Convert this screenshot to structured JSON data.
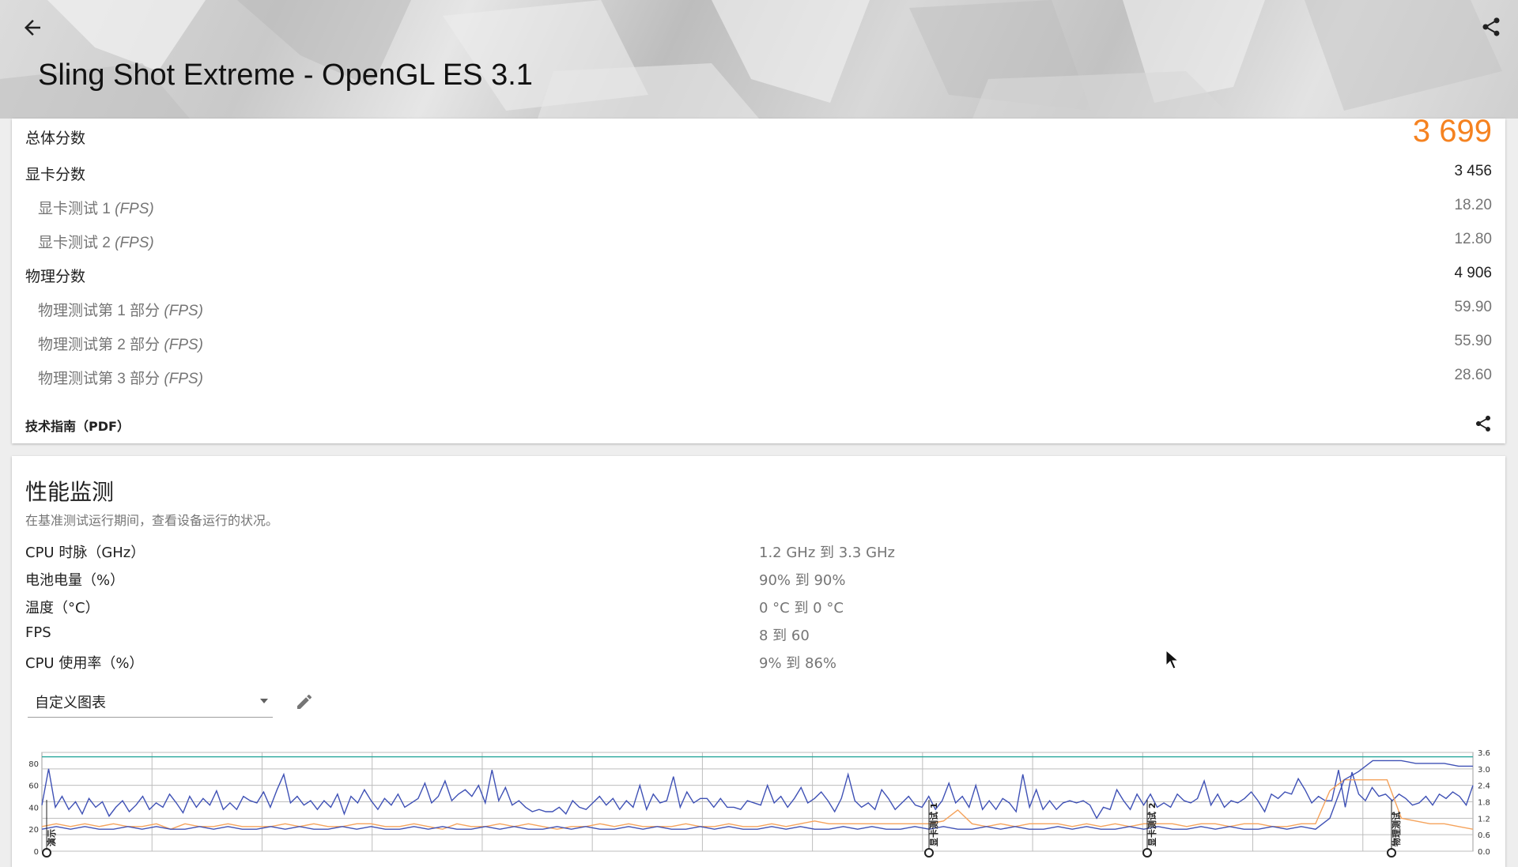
{
  "header": {
    "title": "Sling Shot Extreme - OpenGL ES 3.1",
    "back_icon": "arrow-left-icon",
    "share_icon": "share-icon"
  },
  "scores": {
    "total": {
      "label": "总体分数",
      "value": "3 699"
    },
    "graphics": {
      "label": "显卡分数",
      "value": "3 456"
    },
    "graphics_test1": {
      "label": "显卡测试 1 ",
      "unit": "(FPS)",
      "value": "18.20"
    },
    "graphics_test2": {
      "label": "显卡测试 2 ",
      "unit": "(FPS)",
      "value": "12.80"
    },
    "physics": {
      "label": "物理分数",
      "value": "4 906"
    },
    "physics_test1": {
      "label": "物理测试第 1 部分 ",
      "unit": "(FPS)",
      "value": "59.90"
    },
    "physics_test2": {
      "label": "物理测试第 2 部分 ",
      "unit": "(FPS)",
      "value": "55.90"
    },
    "physics_test3": {
      "label": "物理测试第 3 部分 ",
      "unit": "(FPS)",
      "value": "28.60"
    },
    "pdf_label": "技术指南（PDF）"
  },
  "monitor": {
    "title": "性能监测",
    "description": "在基准测试运行期间，查看设备运行的状况。",
    "stats": [
      {
        "label": "CPU 时脉（GHz）",
        "value": "1.2 GHz 到 3.3 GHz"
      },
      {
        "label": "电池电量（%）",
        "value": "90% 到 90%"
      },
      {
        "label": "温度（°C）",
        "value": "0 °C 到 0 °C"
      },
      {
        "label": "FPS",
        "value": "8 到 60"
      },
      {
        "label": "CPU 使用率（%）",
        "value": "9% 到 86%"
      }
    ],
    "dropdown_value": "自定义图表",
    "edit_icon": "pencil-icon"
  },
  "colors": {
    "accent": "#f58220",
    "fps_line": "#3f51b5",
    "battery_line": "#26a69a",
    "clock_line": "#f5a35c"
  },
  "chart_data": {
    "type": "line",
    "left_axis_ticks": [
      "80",
      "60",
      "40",
      "20",
      "0"
    ],
    "right_axis_ticks": [
      "3.6",
      "3.0",
      "2.4",
      "1.8",
      "1.2",
      "0.6",
      "0.0"
    ],
    "markers": [
      {
        "label": "演示"
      },
      {
        "label": "显卡测试 1"
      },
      {
        "label": "显卡测试 2"
      },
      {
        "label": "物理测试"
      }
    ],
    "series": [
      {
        "color": "#3f51b5",
        "axis": "left",
        "values": [
          42,
          75,
          40,
          50,
          38,
          45,
          34,
          48,
          40,
          45,
          32,
          40,
          46,
          36,
          42,
          50,
          38,
          44,
          40,
          52,
          44,
          35,
          50,
          40,
          48,
          42,
          55,
          38,
          44,
          38,
          50,
          46,
          44,
          54,
          40,
          56,
          70,
          44,
          50,
          42,
          46,
          38,
          46,
          40,
          52,
          34,
          50,
          44,
          56,
          46,
          38,
          48,
          42,
          52,
          40,
          44,
          48,
          62,
          44,
          50,
          64,
          46,
          52,
          56,
          50,
          60,
          44,
          74,
          46,
          58,
          42,
          46,
          40,
          36,
          38,
          36,
          36,
          40,
          34,
          46,
          40,
          38,
          44,
          50,
          42,
          48,
          38,
          46,
          40,
          60,
          38,
          52,
          44,
          46,
          68,
          40,
          54,
          44,
          48,
          48,
          40,
          48,
          40,
          40,
          38,
          46,
          44,
          42,
          60,
          44,
          50,
          40,
          48,
          58,
          44,
          48,
          54,
          46,
          36,
          48,
          70,
          46,
          40,
          44,
          38,
          56,
          48,
          38,
          44,
          50,
          42,
          40,
          50,
          38,
          46,
          62,
          44,
          50,
          40,
          60,
          38,
          46,
          38,
          48,
          44,
          36,
          70,
          40,
          56,
          38,
          46,
          38,
          44,
          46,
          44,
          46,
          42,
          30,
          40,
          38,
          56,
          46,
          38,
          52,
          42,
          52,
          40,
          44,
          40,
          52,
          46,
          44,
          48,
          64,
          42,
          52,
          40,
          46,
          44,
          48,
          54,
          46,
          36,
          52,
          48,
          54,
          52,
          66,
          56,
          44,
          50,
          46,
          46,
          74,
          40,
          72,
          52,
          46,
          58,
          50,
          52,
          46,
          52,
          48,
          42,
          44,
          50,
          42,
          52,
          48,
          54,
          50,
          42,
          60
        ]
      },
      {
        "color": "#26a69a",
        "axis": "left",
        "values": [
          86,
          86,
          86,
          86,
          86,
          86,
          86,
          86,
          86,
          86,
          86,
          86,
          86,
          86,
          86
        ]
      },
      {
        "color": "#f5a35c",
        "axis": "right",
        "values": [
          0.9,
          1.0,
          0.9,
          1.0,
          0.9,
          1.0,
          0.9,
          0.9,
          1.0,
          0.8,
          1.0,
          0.9,
          0.9,
          1.0,
          0.9,
          0.9,
          0.9,
          1.0,
          0.9,
          1.0,
          0.9,
          0.9,
          1.0,
          1.0,
          0.9,
          0.9,
          1.0,
          0.9,
          0.8,
          1.0,
          0.9,
          0.9,
          1.0,
          0.9,
          1.0,
          0.9,
          0.8,
          0.9,
          0.9,
          1.0,
          0.9,
          1.0,
          0.9,
          0.9,
          0.9,
          1.0,
          0.9,
          0.9,
          1.0,
          0.9,
          0.9,
          1.0,
          0.9,
          1.0,
          1.1,
          1.0,
          1.0,
          1.0,
          1.0,
          1.0,
          1.0,
          1.0,
          1.0,
          1.1,
          1.5,
          1.0,
          0.9,
          1.0,
          0.9,
          1.0,
          1.0,
          1.0,
          0.9,
          1.0,
          0.9,
          1.0,
          0.9,
          1.0,
          1.0,
          1.0,
          0.9,
          1.0,
          1.0,
          0.9,
          1.0,
          1.0,
          0.9,
          0.9,
          1.0,
          1.0,
          2.2,
          2.6,
          2.6,
          2.6,
          2.6,
          1.2,
          1.1,
          1.0,
          1.0,
          0.9,
          0.8
        ]
      },
      {
        "color": "#3f51b5",
        "axis": "right",
        "values": [
          0.8,
          0.9,
          0.8,
          0.9,
          0.8,
          0.8,
          0.9,
          0.8,
          0.9,
          0.8,
          0.8,
          0.9,
          0.8,
          0.9,
          0.8,
          0.8,
          0.9,
          0.8,
          0.9,
          0.8,
          0.8,
          0.9,
          0.8,
          0.9,
          0.8,
          0.8,
          0.9,
          0.8,
          0.9,
          0.8,
          0.8,
          0.9,
          0.8,
          0.9,
          0.8,
          0.8,
          0.9,
          0.8,
          0.9,
          0.8,
          0.8,
          0.9,
          0.8,
          0.9,
          0.8,
          0.8,
          0.9,
          0.8,
          0.9,
          0.8,
          0.8,
          0.9,
          0.8,
          0.9,
          0.8,
          0.8,
          0.9,
          0.8,
          0.9,
          0.8,
          0.8,
          0.9,
          0.8,
          0.9,
          0.8,
          0.8,
          0.9,
          0.8,
          0.9,
          0.8,
          0.8,
          0.9,
          0.8,
          0.9,
          0.8,
          0.8,
          0.9,
          0.8,
          0.9,
          0.8,
          0.8,
          0.9,
          0.8,
          0.9,
          0.8,
          0.8,
          0.9,
          0.8,
          0.9,
          0.8,
          1.2,
          2.6,
          2.9,
          3.3,
          3.3,
          3.3,
          3.2,
          3.2,
          3.2,
          3.1,
          3.1
        ]
      }
    ]
  }
}
